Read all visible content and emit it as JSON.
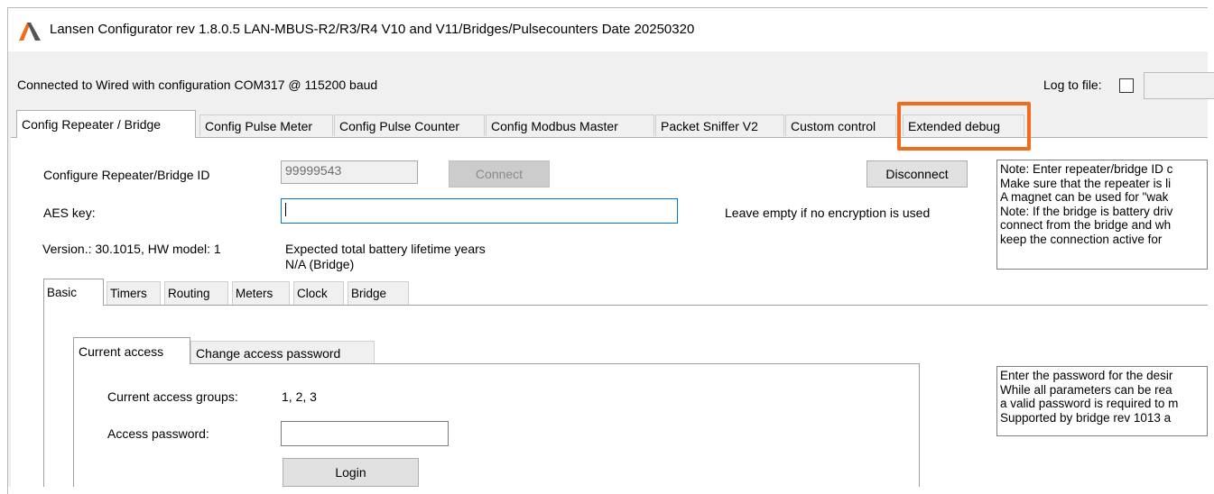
{
  "window": {
    "title": "Lansen Configurator rev 1.8.0.5 LAN-MBUS-R2/R3/R4 V10 and V11/Bridges/Pulsecounters Date 20250320",
    "logo_icon": "lansen-logo-icon",
    "accent_color": "#f26a1b"
  },
  "status": {
    "connection_text": "Connected to Wired with configuration COM317 @ 115200 baud",
    "log_to_file_label": "Log to file:",
    "log_to_file_checked": false
  },
  "main_tabs": [
    {
      "label": "Config Repeater / Bridge",
      "active": true
    },
    {
      "label": "Config Pulse Meter"
    },
    {
      "label": "Config Pulse Counter"
    },
    {
      "label": "Config Modbus Master"
    },
    {
      "label": "Packet Sniffer V2"
    },
    {
      "label": "Custom control"
    },
    {
      "label": "Extended debug",
      "highlighted": true
    }
  ],
  "repeater": {
    "id_label": "Configure Repeater/Bridge ID",
    "id_value": "99999543",
    "connect_label": "Connect",
    "disconnect_label": "Disconnect",
    "aes_label": "AES key:",
    "aes_value": "",
    "aes_hint": "Leave empty if no encryption is used",
    "version_text": "Version.: 30.1015, HW model: 1",
    "battery_label": "Expected total battery lifetime years",
    "battery_value": "N/A (Bridge)",
    "note_lines": [
      "Note: Enter repeater/bridge ID c",
      "Make sure that the repeater is li",
      "A magnet can be used for \"wak",
      "Note: If the bridge is battery driv",
      "connect from the bridge and wh",
      "keep the connection active for"
    ]
  },
  "sub_tabs": [
    {
      "label": "Basic",
      "active": true
    },
    {
      "label": "Timers"
    },
    {
      "label": "Routing"
    },
    {
      "label": "Meters"
    },
    {
      "label": "Clock"
    },
    {
      "label": "Bridge"
    }
  ],
  "access_tabs": [
    {
      "label": "Current access",
      "active": true
    },
    {
      "label": "Change access password"
    }
  ],
  "access": {
    "groups_label": "Current access groups:",
    "groups_value": "1, 2, 3",
    "password_label": "Access password:",
    "password_value": "",
    "login_label": "Login",
    "help_lines": [
      "Enter the password for the desir",
      "While all parameters can be rea",
      "a valid password is required to m",
      "Supported by bridge rev 1013 a"
    ]
  }
}
